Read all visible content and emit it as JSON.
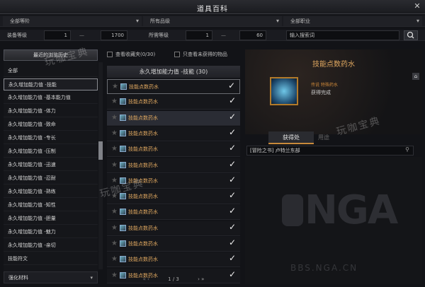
{
  "window": {
    "title": "道具百科"
  },
  "filters": {
    "row1": [
      {
        "label": "全部等阶"
      },
      {
        "label": "所有品级"
      },
      {
        "label": "全部职业"
      }
    ],
    "item_level_label": "装备等级",
    "item_level_min": "1",
    "item_level_max": "1700",
    "req_level_label": "所需等级",
    "req_level_min": "1",
    "req_level_max": "60",
    "search_placeholder": "输入搜索词"
  },
  "left": {
    "recent_label": "最近的浏览历史",
    "categories": [
      "全部",
      "永久增加能力值 -技能",
      "永久增加能力值 -基本能力值",
      "永久增加能力值 -体力",
      "永久增加能力值 -致命",
      "永久增加能力值 -专长",
      "永久增加能力值 -压制",
      "永久增加能力值 -迅速",
      "永久增加能力值 -忍耐",
      "永久增加能力值 -熟练",
      "永久增加能力值 -知性",
      "永久增加能力值 -胆量",
      "永久增加能力值 -魅力",
      "永久增加能力值 -亲切",
      "技能符文"
    ],
    "bottom_category": "强化材料"
  },
  "options": {
    "favorites": "查看收藏夹(0/30)",
    "unowned": "只查看未获得的物品"
  },
  "list": {
    "header": "永久增加能力值 -技能 (30)",
    "items": [
      "技能点数药水",
      "技能点数药水",
      "技能点数药水",
      "技能点数药水",
      "技能点数药水",
      "技能点数药水",
      "技能点数药水",
      "技能点数药水",
      "技能点数药水",
      "技能点数药水",
      "技能点数药水",
      "技能点数药水",
      "技能点数药水"
    ],
    "page": "1 / 3"
  },
  "detail": {
    "name": "技能点数药水",
    "grade": "传说 特殊药水",
    "status": "获得完成",
    "tab_source": "获得处",
    "tab_use": "用途",
    "source_text": "[冒险之书] 卢特兰东部"
  },
  "watermarks": {
    "text1": "玩咖宝典",
    "text2": "玩咖宝典",
    "text3": "玩咖宝典",
    "logo": "NGA",
    "logo_sub": "BBS.NGA.CN"
  },
  "colors": {
    "accent": "#c98a3a",
    "item_name": "#e0a860"
  }
}
